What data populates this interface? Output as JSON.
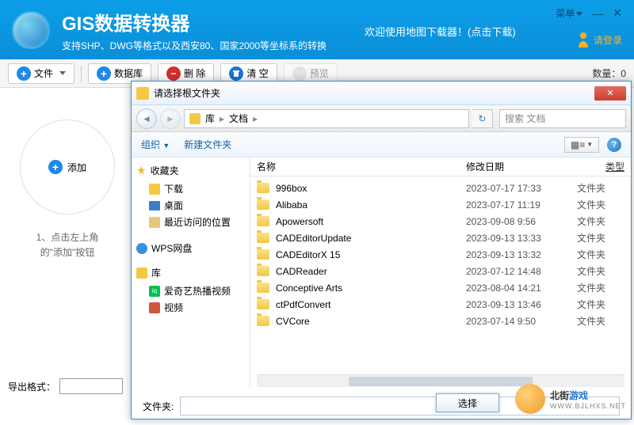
{
  "header": {
    "title": "GIS数据转换器",
    "subtitle": "支持SHP、DWG等格式以及西安80、国家2000等坐标系的转换",
    "promo": "欢迎使用地图下载器！(点击下载)",
    "menu": "菜单",
    "login": "请登录"
  },
  "toolbar": {
    "file": "文件",
    "database": "数据库",
    "delete": "删 除",
    "clear": "清 空",
    "preview": "预览",
    "count_label": "数量：0"
  },
  "left": {
    "add": "添加",
    "hint_line1": "1、点击左上角",
    "hint_line2": "的\"添加\"按钮",
    "export_label": "导出格式："
  },
  "dialog": {
    "title": "请选择根文件夹",
    "breadcrumb": {
      "lib": "库",
      "docs": "文档"
    },
    "search_placeholder": "搜索 文档",
    "organize": "组织",
    "new_folder": "新建文件夹",
    "view_label": "▦≡",
    "cols": {
      "name": "名称",
      "date": "修改日期",
      "type": "类型"
    },
    "tree": {
      "favorites": "收藏夹",
      "downloads": "下载",
      "desktop": "桌面",
      "recent": "最近访问的位置",
      "wps": "WPS网盘",
      "library": "库",
      "iqiyi": "爱奇艺热播视频",
      "video": "视频"
    },
    "files": [
      {
        "name": "996box",
        "date": "2023-07-17 17:33",
        "type": "文件夹"
      },
      {
        "name": "Alibaba",
        "date": "2023-07-17 11:19",
        "type": "文件夹"
      },
      {
        "name": "Apowersoft",
        "date": "2023-09-08 9:56",
        "type": "文件夹"
      },
      {
        "name": "CADEditorUpdate",
        "date": "2023-09-13 13:33",
        "type": "文件夹"
      },
      {
        "name": "CADEditorX 15",
        "date": "2023-09-13 13:32",
        "type": "文件夹"
      },
      {
        "name": "CADReader",
        "date": "2023-07-12 14:48",
        "type": "文件夹"
      },
      {
        "name": "Conceptive Arts",
        "date": "2023-08-04 14:21",
        "type": "文件夹"
      },
      {
        "name": "ctPdfConvert",
        "date": "2023-09-13 13:46",
        "type": "文件夹"
      },
      {
        "name": "CVCore",
        "date": "2023-07-14 9:50",
        "type": "文件夹"
      }
    ],
    "folder_label": "文件夹:",
    "select_btn": "选择"
  },
  "watermark": {
    "main_a": "北街",
    "main_b": "游戏",
    "sub": "WWW.BJLHXS.NET"
  }
}
